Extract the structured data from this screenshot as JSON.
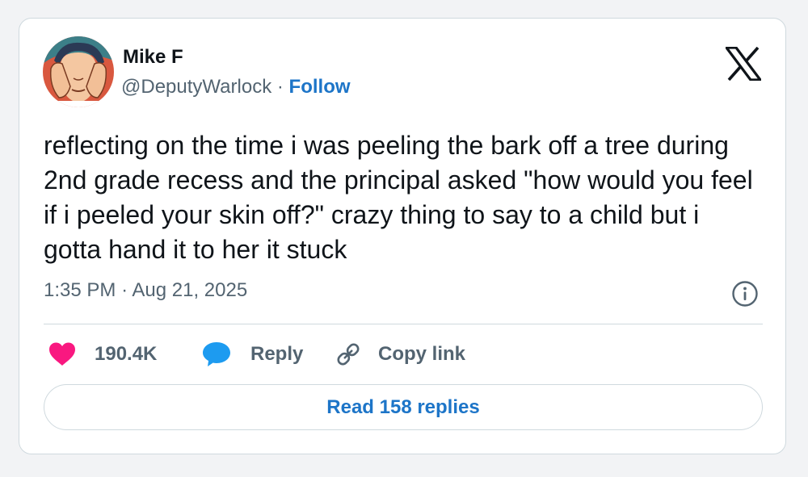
{
  "author": {
    "name": "Mike F",
    "handle": "@DeputyWarlock",
    "separator": "·",
    "follow_label": "Follow"
  },
  "brand_icon": "x-logo-icon",
  "tweet": {
    "text": "reflecting on the time i was peeling the bark off a tree during 2nd grade recess and the principal asked \"how would you feel if i peeled your skin off?\" crazy thing to say to a child but i gotta hand it to her it stuck",
    "time": "1:35 PM",
    "date_separator": "·",
    "date": "Aug 21, 2025"
  },
  "actions": {
    "like_count": "190.4K",
    "reply_label": "Reply",
    "copy_link_label": "Copy link"
  },
  "read_replies_label": "Read 158 replies",
  "colors": {
    "like": "#f91880",
    "reply": "#1d9bf0",
    "link": "#1d75c8",
    "text": "#0f1419",
    "muted": "#536471",
    "border": "#cfd9de"
  }
}
